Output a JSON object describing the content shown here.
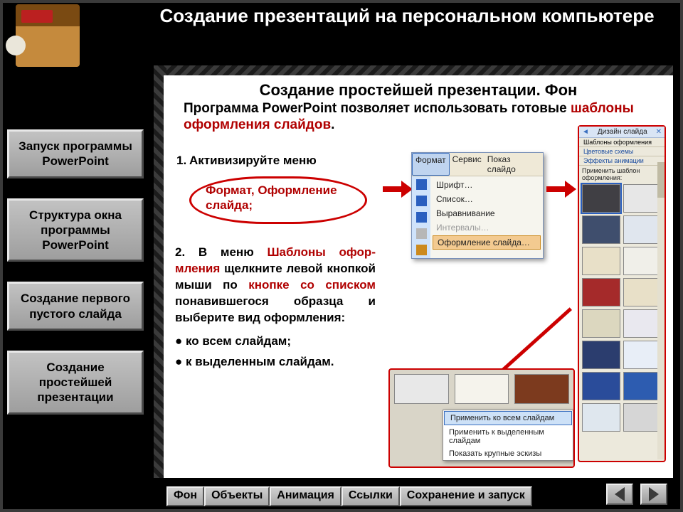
{
  "title": "Создание презентаций на персональном компьютере",
  "sidebar": {
    "items": [
      {
        "label": "Запуск программы PowerPoint"
      },
      {
        "label": "Структура окна программы PowerPoint"
      },
      {
        "label": "Создание первого пустого слайда"
      },
      {
        "label": "Создание простейшей презентации"
      }
    ]
  },
  "subtitle": "Создание простейшей презентации. Фон",
  "intro": {
    "pre": "Программа PowerPoint позволяет использовать готовые ",
    "hl": "шаблоны оформления слайдов",
    "post": "."
  },
  "step1": {
    "num": "1.",
    "line": "Активизируйте меню",
    "circled": "Формат, Оформление слайда;"
  },
  "format_menu": {
    "menubar": [
      "Формат",
      "Сервис",
      "Показ слайдо"
    ],
    "items": [
      {
        "label": "Шрифт…",
        "disabled": false
      },
      {
        "label": "Список…",
        "disabled": false
      },
      {
        "label": "Выравнивание",
        "disabled": false,
        "sub": true
      },
      {
        "label": "Интервалы…",
        "disabled": true
      },
      {
        "label": "Оформление слайда…",
        "selected": true
      }
    ]
  },
  "task_pane": {
    "title": "Дизайн слайда",
    "links": [
      "Шаблоны оформления",
      "Цветовые схемы",
      "Эффекты анимации"
    ],
    "heading": "Применить шаблон оформления:",
    "thumb_colors": [
      "#403f44",
      "#e7e7e7",
      "#3f4e6d",
      "#e0e6ee",
      "#e8e0c8",
      "#f0efe9",
      "#a52a2a",
      "#e8e0c8",
      "#dcd7bf",
      "#e9e8ef",
      "#2b3d6e",
      "#e8eef7",
      "#2a4c9a",
      "#2d5cb0",
      "#dfe7ee",
      "#d6d6d6"
    ]
  },
  "step2": {
    "pre": "2. В меню ",
    "hl1": "Шаблоны офор-мления",
    "mid1": " щелкните левой кнопкой мыши по ",
    "hl2": "кнопке со списком",
    "mid2": " понавившегося образца и выберите вид оформления:",
    "bullets": [
      "ко всем слайдам;",
      "к выделенным слайдам."
    ]
  },
  "ctx": {
    "thumbs": [
      "#e8e8e8",
      "#f5f3ec",
      "#7c3a1e"
    ],
    "items": [
      "Применить ко всем слайдам",
      "Применить к выделенным слайдам",
      "Показать крупные эскизы"
    ],
    "selected": 0
  },
  "tabs": [
    "Фон",
    "Объекты",
    "Анимация",
    "Ссылки",
    "Сохранение и запуск"
  ]
}
